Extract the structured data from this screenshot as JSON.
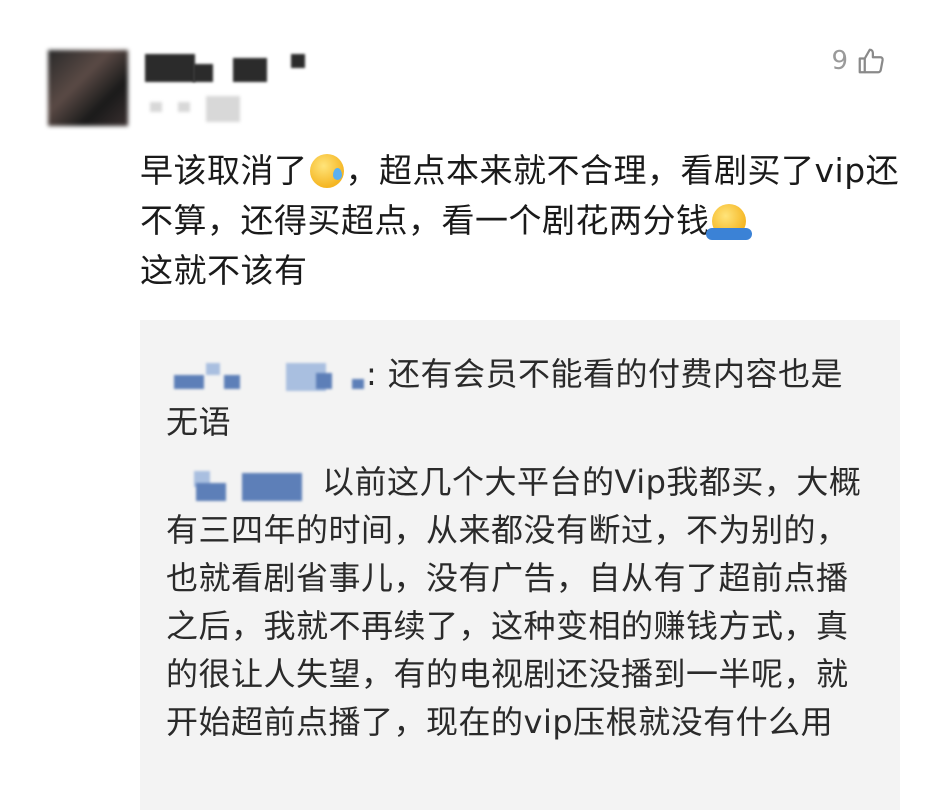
{
  "comment": {
    "likes": "9",
    "text_part1": "早该取消了",
    "text_part2": "，超点本来就不合理，看剧买了vip还不算，还得买超点，看一个剧花两分钱",
    "text_part3": "这就不该有"
  },
  "replies": [
    {
      "text_line1": ": 还有会员不能看的付费内容也是",
      "text_line2": "无语"
    },
    {
      "text": "以前这几个大平台的Vip我都买，大概有三四年的时间，从来都没有断过，不为别的，也就看剧省事儿，没有广告，自从有了超前点播之后，我就不再续了，这种变相的赚钱方式，真的很让人失望，有的电视剧还没播到一半呢，就开始超前点播了，现在的vip压根就没有什么用"
    }
  ],
  "icons": {
    "like": "thumbs-up-outline-icon",
    "emoji1": "sweat-face-emoji",
    "emoji2": "shrug-person-emoji"
  },
  "colors": {
    "reply_background": "#f3f3f3",
    "username_link": "#5d7fb8",
    "like_count": "#9a9a9a"
  }
}
